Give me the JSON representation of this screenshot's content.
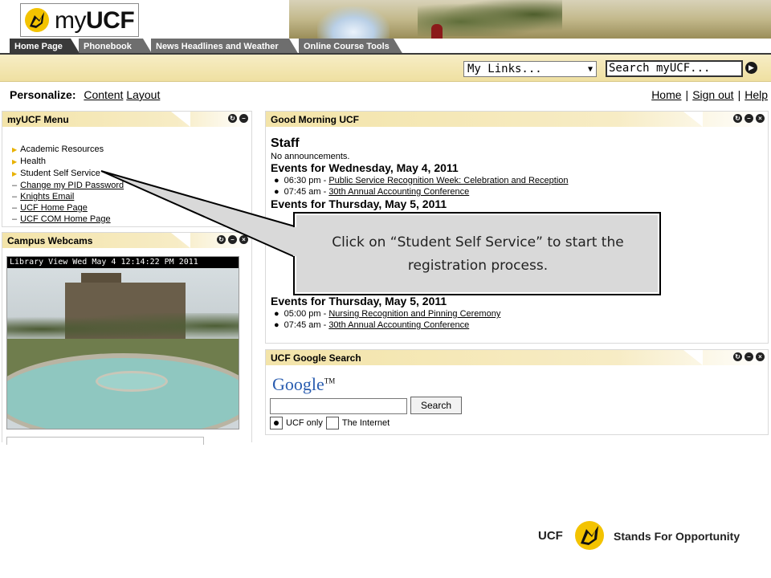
{
  "header": {
    "logo_prefix": "my",
    "logo_brand": "UCF"
  },
  "tabs": [
    {
      "label": "Home Page"
    },
    {
      "label": "Phonebook"
    },
    {
      "label": "News Headlines and Weather"
    },
    {
      "label": "Online Course Tools"
    }
  ],
  "toolbar": {
    "mylinks_value": "My Links...",
    "search_value": "Search myUCF...",
    "dropdown_caret": "▼",
    "go_glyph": "▶"
  },
  "personalize": {
    "label": "Personalize:",
    "content": "Content",
    "layout": "Layout"
  },
  "top_links": {
    "home": "Home",
    "sign_out": "Sign out",
    "help": "Help",
    "separator": "|"
  },
  "menu_portlet": {
    "title": "myUCF Menu",
    "items": [
      {
        "label": "Academic Resources"
      },
      {
        "label": "Health"
      },
      {
        "label": "Student Self Service"
      }
    ],
    "links": [
      {
        "label": "Change my PID Password"
      },
      {
        "label": "Knights Email"
      },
      {
        "label": "UCF Home Page"
      },
      {
        "label": "UCF COM Home Page"
      }
    ]
  },
  "webcam_portlet": {
    "title": "Campus Webcams",
    "caption": "Library View  Wed May  4  12:14:22 PM  2011"
  },
  "gm_portlet": {
    "title": "Good Morning UCF",
    "staff_heading": "Staff",
    "no_announcements": "No announcements.",
    "day1_heading": "Events for Wednesday, May 4, 2011",
    "day1_events": [
      {
        "time": "06:30 pm -",
        "title": "Public Service Recognition Week: Celebration and Reception"
      },
      {
        "time": "07:45 am -",
        "title": "30th Annual Accounting Conference"
      }
    ],
    "day2_heading": "Events for Thursday, May 5, 2011",
    "day2_events": [
      {
        "time": "05:00 pm -",
        "title": "Nursing Recognition and Pinning Ceremony"
      },
      {
        "time": "07:45 am -",
        "title": "30th Annual Accounting Conference"
      }
    ]
  },
  "google_portlet": {
    "title": "UCF Google Search",
    "logo": "Google",
    "tm": "TM",
    "button": "Search",
    "radio_ucf": "UCF only",
    "radio_internet": "The Internet"
  },
  "callout": {
    "text": "Click on “Student Self Service” to start the registration process."
  },
  "footer": {
    "brand": "UCF",
    "tagline": "Stands For Opportunity"
  },
  "colors": {
    "accent_gold": "#f3c300",
    "tab_active": "#3a3a3a",
    "tab_inactive": "#6e6e6e",
    "portlet_header": "#f3e4a9"
  }
}
